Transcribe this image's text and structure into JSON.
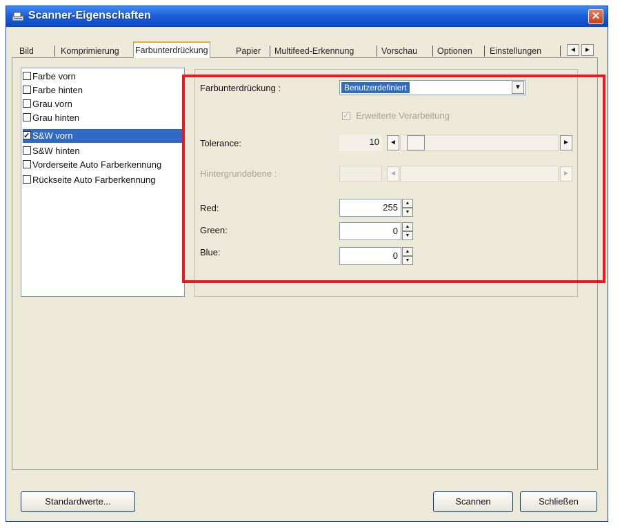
{
  "window": {
    "title": "Scanner-Eigenschaften",
    "close_label": "✕"
  },
  "tabs": [
    {
      "label": "Bild"
    },
    {
      "label": "Komprimierung"
    },
    {
      "label": "Farbunterdrückung",
      "active": true
    },
    {
      "label": "Papier"
    },
    {
      "label": "Multifeed-Erkennung"
    },
    {
      "label": "Vorschau"
    },
    {
      "label": "Optionen"
    },
    {
      "label": "Einstellungen"
    }
  ],
  "tab_scroll": {
    "left": "◄",
    "right": "►"
  },
  "image_list": {
    "items": [
      {
        "label": "Farbe vorn",
        "checked": false
      },
      {
        "label": "Farbe hinten",
        "checked": false
      },
      {
        "label": "Grau vorn",
        "checked": false
      },
      {
        "label": "Grau hinten",
        "checked": false
      },
      {
        "label": "S&W vorn",
        "checked": true,
        "selected": true
      },
      {
        "label": "S&W hinten",
        "checked": false
      },
      {
        "label": "Vorderseite Auto Farberkennung",
        "checked": false
      },
      {
        "label": "Rückseite Auto Farberkennung",
        "checked": false
      }
    ]
  },
  "settings": {
    "dropout_label": "Farbunterdrückung :",
    "dropout_value": "Benutzerdefiniert",
    "dropdown_arrow": "▼",
    "advanced_label": "Erweiterte Verarbeitung",
    "advanced_checked": true,
    "tolerance_label": "Tolerance:",
    "tolerance_value": "10",
    "background_label": "Hintergrundebene :",
    "background_value": "",
    "left_arrow": "◄",
    "right_arrow": "►",
    "red_label": "Red:",
    "red_value": "255",
    "green_label": "Green:",
    "green_value": "0",
    "blue_label": "Blue:",
    "blue_value": "0",
    "spin_up": "▲",
    "spin_down": "▼"
  },
  "buttons": {
    "defaults": "Standardwerte...",
    "scan": "Scannen",
    "close": "Schließen"
  },
  "colors": {
    "titlebar": "#1f5fd6",
    "selection": "#316ac5",
    "highlight_frame": "#e8191f"
  }
}
